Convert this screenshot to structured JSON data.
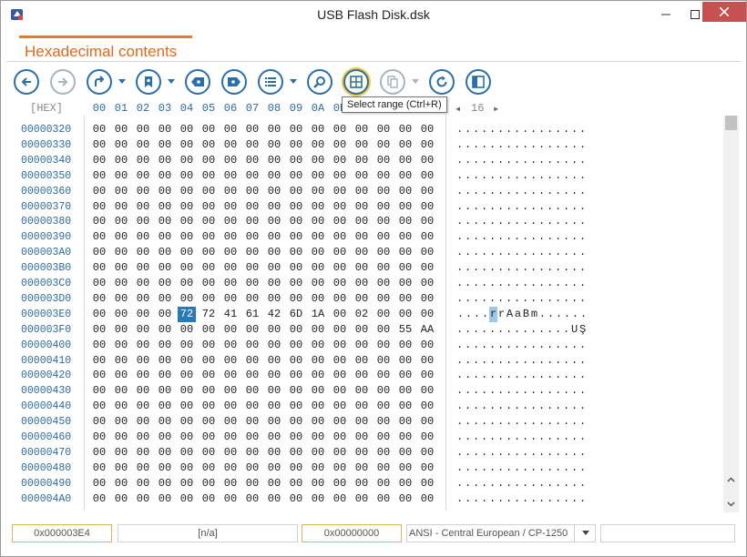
{
  "window": {
    "title": "USB Flash Disk.dsk"
  },
  "tab": {
    "label": "Hexadecimal contents",
    "accent_color": "#e07b30"
  },
  "toolbar": {
    "buttons": [
      {
        "icon": "arrow-left-icon",
        "enabled": true
      },
      {
        "icon": "arrow-right-icon",
        "enabled": false
      },
      {
        "icon": "redirect-icon",
        "enabled": true,
        "dropdown": true
      },
      {
        "icon": "bookmark-icon",
        "enabled": true,
        "dropdown": true
      },
      {
        "icon": "previous-bookmark-icon",
        "enabled": true
      },
      {
        "icon": "next-bookmark-icon",
        "enabled": true
      },
      {
        "icon": "list-icon",
        "enabled": true,
        "dropdown": true
      },
      {
        "icon": "search-icon",
        "enabled": true
      },
      {
        "icon": "select-range-icon",
        "enabled": true,
        "active": true
      },
      {
        "icon": "copy-icon",
        "enabled": false,
        "dropdown": true
      },
      {
        "icon": "refresh-icon",
        "enabled": true
      },
      {
        "icon": "panel-icon",
        "enabled": true
      }
    ],
    "tooltip": "Select range (Ctrl+R)"
  },
  "hex_view": {
    "header_label": "[HEX]",
    "byte_headers": [
      "00",
      "01",
      "02",
      "03",
      "04",
      "05",
      "06",
      "07",
      "08",
      "09",
      "0A",
      "0B"
    ],
    "bytes_per_row_label": "16",
    "nav_left": "◂",
    "nav_right": "▸",
    "rows": [
      {
        "offset": "00000320",
        "bytes": [
          "00",
          "00",
          "00",
          "00",
          "00",
          "00",
          "00",
          "00",
          "00",
          "00",
          "00",
          "00",
          "00",
          "00",
          "00",
          "00"
        ],
        "ascii": "................"
      },
      {
        "offset": "00000330",
        "bytes": [
          "00",
          "00",
          "00",
          "00",
          "00",
          "00",
          "00",
          "00",
          "00",
          "00",
          "00",
          "00",
          "00",
          "00",
          "00",
          "00"
        ],
        "ascii": "................"
      },
      {
        "offset": "00000340",
        "bytes": [
          "00",
          "00",
          "00",
          "00",
          "00",
          "00",
          "00",
          "00",
          "00",
          "00",
          "00",
          "00",
          "00",
          "00",
          "00",
          "00"
        ],
        "ascii": "................"
      },
      {
        "offset": "00000350",
        "bytes": [
          "00",
          "00",
          "00",
          "00",
          "00",
          "00",
          "00",
          "00",
          "00",
          "00",
          "00",
          "00",
          "00",
          "00",
          "00",
          "00"
        ],
        "ascii": "................"
      },
      {
        "offset": "00000360",
        "bytes": [
          "00",
          "00",
          "00",
          "00",
          "00",
          "00",
          "00",
          "00",
          "00",
          "00",
          "00",
          "00",
          "00",
          "00",
          "00",
          "00"
        ],
        "ascii": "................"
      },
      {
        "offset": "00000370",
        "bytes": [
          "00",
          "00",
          "00",
          "00",
          "00",
          "00",
          "00",
          "00",
          "00",
          "00",
          "00",
          "00",
          "00",
          "00",
          "00",
          "00"
        ],
        "ascii": "................"
      },
      {
        "offset": "00000380",
        "bytes": [
          "00",
          "00",
          "00",
          "00",
          "00",
          "00",
          "00",
          "00",
          "00",
          "00",
          "00",
          "00",
          "00",
          "00",
          "00",
          "00"
        ],
        "ascii": "................"
      },
      {
        "offset": "00000390",
        "bytes": [
          "00",
          "00",
          "00",
          "00",
          "00",
          "00",
          "00",
          "00",
          "00",
          "00",
          "00",
          "00",
          "00",
          "00",
          "00",
          "00"
        ],
        "ascii": "................"
      },
      {
        "offset": "000003A0",
        "bytes": [
          "00",
          "00",
          "00",
          "00",
          "00",
          "00",
          "00",
          "00",
          "00",
          "00",
          "00",
          "00",
          "00",
          "00",
          "00",
          "00"
        ],
        "ascii": "................"
      },
      {
        "offset": "000003B0",
        "bytes": [
          "00",
          "00",
          "00",
          "00",
          "00",
          "00",
          "00",
          "00",
          "00",
          "00",
          "00",
          "00",
          "00",
          "00",
          "00",
          "00"
        ],
        "ascii": "................"
      },
      {
        "offset": "000003C0",
        "bytes": [
          "00",
          "00",
          "00",
          "00",
          "00",
          "00",
          "00",
          "00",
          "00",
          "00",
          "00",
          "00",
          "00",
          "00",
          "00",
          "00"
        ],
        "ascii": "................"
      },
      {
        "offset": "000003D0",
        "bytes": [
          "00",
          "00",
          "00",
          "00",
          "00",
          "00",
          "00",
          "00",
          "00",
          "00",
          "00",
          "00",
          "00",
          "00",
          "00",
          "00"
        ],
        "ascii": "................"
      },
      {
        "offset": "000003E0",
        "bytes": [
          "00",
          "00",
          "00",
          "00",
          "72",
          "72",
          "41",
          "61",
          "42",
          "6D",
          "1A",
          "00",
          "02",
          "00",
          "00",
          "00"
        ],
        "ascii": "....rrAaBm......",
        "selected_index": 4
      },
      {
        "offset": "000003F0",
        "bytes": [
          "00",
          "00",
          "00",
          "00",
          "00",
          "00",
          "00",
          "00",
          "00",
          "00",
          "00",
          "00",
          "00",
          "00",
          "55",
          "AA"
        ],
        "ascii": "..............UŞ"
      },
      {
        "offset": "00000400",
        "bytes": [
          "00",
          "00",
          "00",
          "00",
          "00",
          "00",
          "00",
          "00",
          "00",
          "00",
          "00",
          "00",
          "00",
          "00",
          "00",
          "00"
        ],
        "ascii": "................"
      },
      {
        "offset": "00000410",
        "bytes": [
          "00",
          "00",
          "00",
          "00",
          "00",
          "00",
          "00",
          "00",
          "00",
          "00",
          "00",
          "00",
          "00",
          "00",
          "00",
          "00"
        ],
        "ascii": "................"
      },
      {
        "offset": "00000420",
        "bytes": [
          "00",
          "00",
          "00",
          "00",
          "00",
          "00",
          "00",
          "00",
          "00",
          "00",
          "00",
          "00",
          "00",
          "00",
          "00",
          "00"
        ],
        "ascii": "................"
      },
      {
        "offset": "00000430",
        "bytes": [
          "00",
          "00",
          "00",
          "00",
          "00",
          "00",
          "00",
          "00",
          "00",
          "00",
          "00",
          "00",
          "00",
          "00",
          "00",
          "00"
        ],
        "ascii": "................"
      },
      {
        "offset": "00000440",
        "bytes": [
          "00",
          "00",
          "00",
          "00",
          "00",
          "00",
          "00",
          "00",
          "00",
          "00",
          "00",
          "00",
          "00",
          "00",
          "00",
          "00"
        ],
        "ascii": "................"
      },
      {
        "offset": "00000450",
        "bytes": [
          "00",
          "00",
          "00",
          "00",
          "00",
          "00",
          "00",
          "00",
          "00",
          "00",
          "00",
          "00",
          "00",
          "00",
          "00",
          "00"
        ],
        "ascii": "................"
      },
      {
        "offset": "00000460",
        "bytes": [
          "00",
          "00",
          "00",
          "00",
          "00",
          "00",
          "00",
          "00",
          "00",
          "00",
          "00",
          "00",
          "00",
          "00",
          "00",
          "00"
        ],
        "ascii": "................"
      },
      {
        "offset": "00000470",
        "bytes": [
          "00",
          "00",
          "00",
          "00",
          "00",
          "00",
          "00",
          "00",
          "00",
          "00",
          "00",
          "00",
          "00",
          "00",
          "00",
          "00"
        ],
        "ascii": "................"
      },
      {
        "offset": "00000480",
        "bytes": [
          "00",
          "00",
          "00",
          "00",
          "00",
          "00",
          "00",
          "00",
          "00",
          "00",
          "00",
          "00",
          "00",
          "00",
          "00",
          "00"
        ],
        "ascii": "................"
      },
      {
        "offset": "00000490",
        "bytes": [
          "00",
          "00",
          "00",
          "00",
          "00",
          "00",
          "00",
          "00",
          "00",
          "00",
          "00",
          "00",
          "00",
          "00",
          "00",
          "00"
        ],
        "ascii": "................"
      },
      {
        "offset": "000004A0",
        "bytes": [
          "00",
          "00",
          "00",
          "00",
          "00",
          "00",
          "00",
          "00",
          "00",
          "00",
          "00",
          "00",
          "00",
          "00",
          "00",
          "00"
        ],
        "ascii": "................"
      }
    ],
    "selection_color": "#2a7ab8"
  },
  "statusbar": {
    "offset": "0x000003E4",
    "value": "[n/a]",
    "selection": "0x00000000",
    "encoding": "ANSI - Central European / CP-1250",
    "extra": ""
  }
}
